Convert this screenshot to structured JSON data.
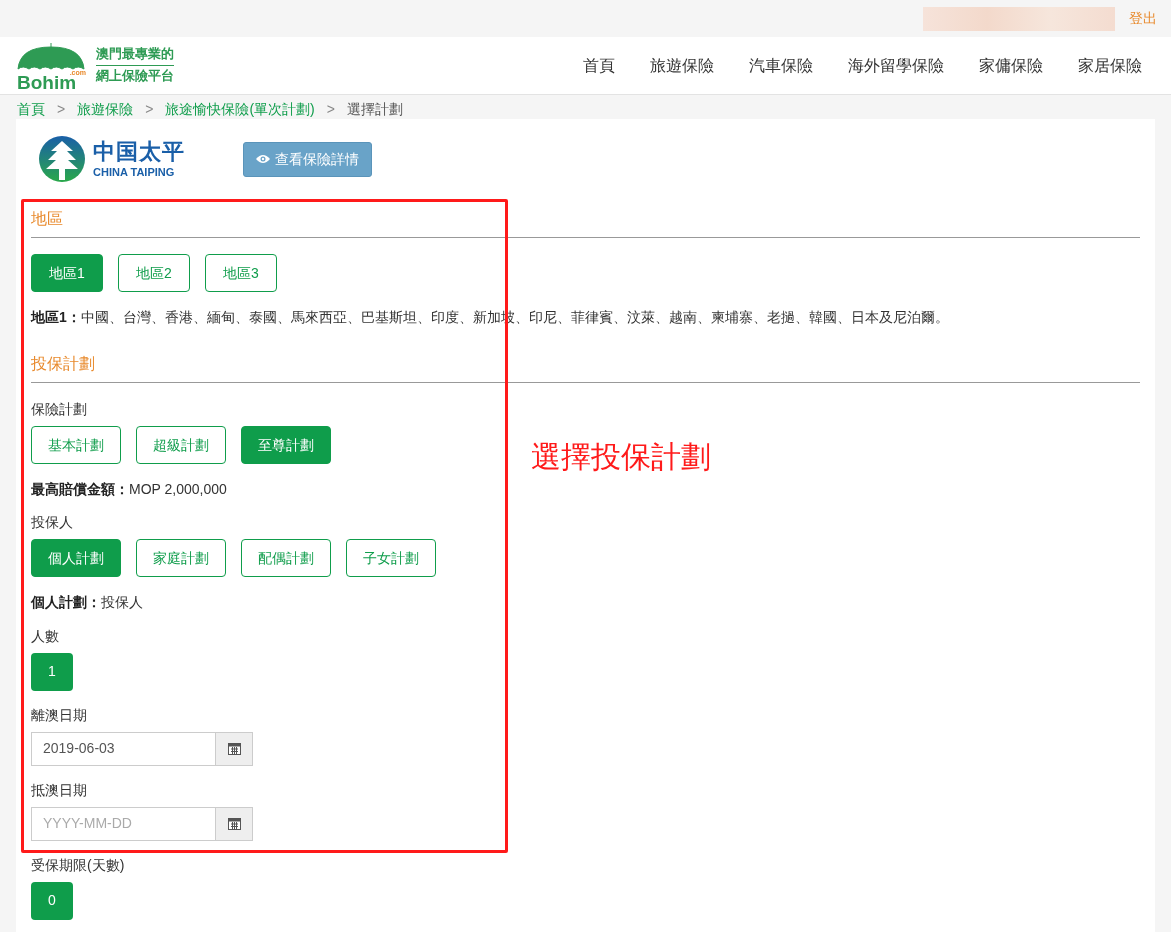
{
  "top_bar": {
    "logout": "登出"
  },
  "logo": {
    "brand": "Bohim",
    "suffix": ".com",
    "slogan": [
      "澳門最專業的",
      "網上保險平台"
    ]
  },
  "nav": [
    {
      "label": "首頁"
    },
    {
      "label": "旅遊保險"
    },
    {
      "label": "汽車保險"
    },
    {
      "label": "海外留學保險"
    },
    {
      "label": "家傭保險"
    },
    {
      "label": "家居保險"
    }
  ],
  "breadcrumb": [
    {
      "label": "首頁",
      "link": true
    },
    {
      "label": "旅遊保險",
      "link": true
    },
    {
      "label": "旅途愉快保險(單次計劃)",
      "link": true
    },
    {
      "label": "選擇計劃",
      "link": false
    }
  ],
  "breadcrumb_separator": ">",
  "insurer": {
    "name_zh": "中国太平",
    "name_en": "CHINA TAIPING"
  },
  "details_button": "查看保險詳情",
  "sections": [
    {
      "title": "地區",
      "fields": [
        {
          "kind": "choice",
          "options": [
            {
              "label": "地區1",
              "selected": true
            },
            {
              "label": "地區2",
              "selected": false
            },
            {
              "label": "地區3",
              "selected": false
            }
          ]
        },
        {
          "kind": "note",
          "text": "**地區1：**中國、台灣、香港、緬甸、泰國、馬來西亞、巴基斯坦、印度、新加坡、印尼、菲律賓、汶萊、越南、柬埔寨、老撾、韓國、日本及尼泊爾。"
        }
      ]
    },
    {
      "title": "投保計劃",
      "fields": [
        {
          "kind": "choice",
          "label": "保險計劃",
          "options": [
            {
              "label": "基本計劃",
              "selected": false
            },
            {
              "label": "超級計劃",
              "selected": false
            },
            {
              "label": "至尊計劃",
              "selected": true
            }
          ]
        },
        {
          "kind": "note",
          "text": "**最高賠償金額：**MOP 2,000,000"
        },
        {
          "kind": "choice",
          "label": "投保人",
          "options": [
            {
              "label": "個人計劃",
              "selected": true
            },
            {
              "label": "家庭計劃",
              "selected": false
            },
            {
              "label": "配偶計劃",
              "selected": false
            },
            {
              "label": "子女計劃",
              "selected": false
            }
          ]
        },
        {
          "kind": "note",
          "text": "**個人計劃：**投保人"
        },
        {
          "kind": "count",
          "label": "人數",
          "value": "1"
        },
        {
          "kind": "date",
          "label": "離澳日期",
          "value": "2019-06-03"
        },
        {
          "kind": "date",
          "label": "抵澳日期",
          "placeholder": "YYYY-MM-DD"
        },
        {
          "kind": "count",
          "label": "受保期限(天數)",
          "value": "0"
        }
      ]
    }
  ],
  "annotation": {
    "text": "選擇投保計劃"
  }
}
